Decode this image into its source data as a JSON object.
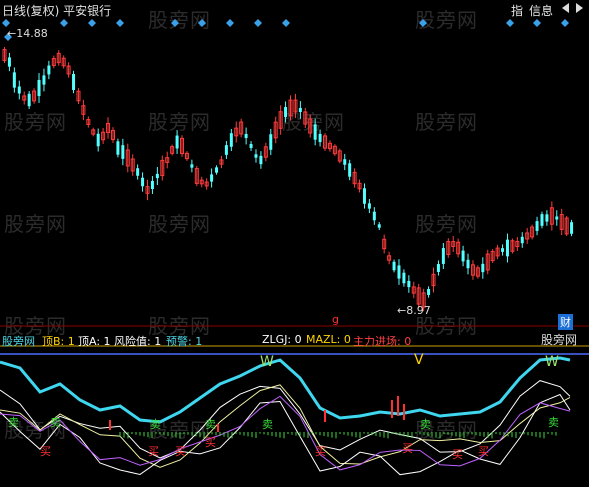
{
  "header": {
    "title": "日线(复权) 平安银行",
    "btn_index": "指",
    "btn_info": "信息"
  },
  "watermark": "股旁网",
  "price": {
    "high_label": "14.88",
    "low_label": "8.97",
    "fin_badge": "财"
  },
  "indicator1": {
    "name": "股旁网",
    "dingB": "顶B: 1",
    "dingA": "顶A: 1",
    "risk": "风险值: 1",
    "alert": "预警: 1"
  },
  "indicator2": {
    "zlgj": "ZLGJ: 0",
    "mazl": "MAZL: 0",
    "entry": "主力进场: 0"
  },
  "stock_name": "股旁网",
  "marks": {
    "buy": "买",
    "sell": "卖",
    "v": "V",
    "w": "W",
    "top_small": "g"
  },
  "colors": {
    "up": "#ff3c3c",
    "down": "#54ffff",
    "accent": "#ffffff"
  }
}
